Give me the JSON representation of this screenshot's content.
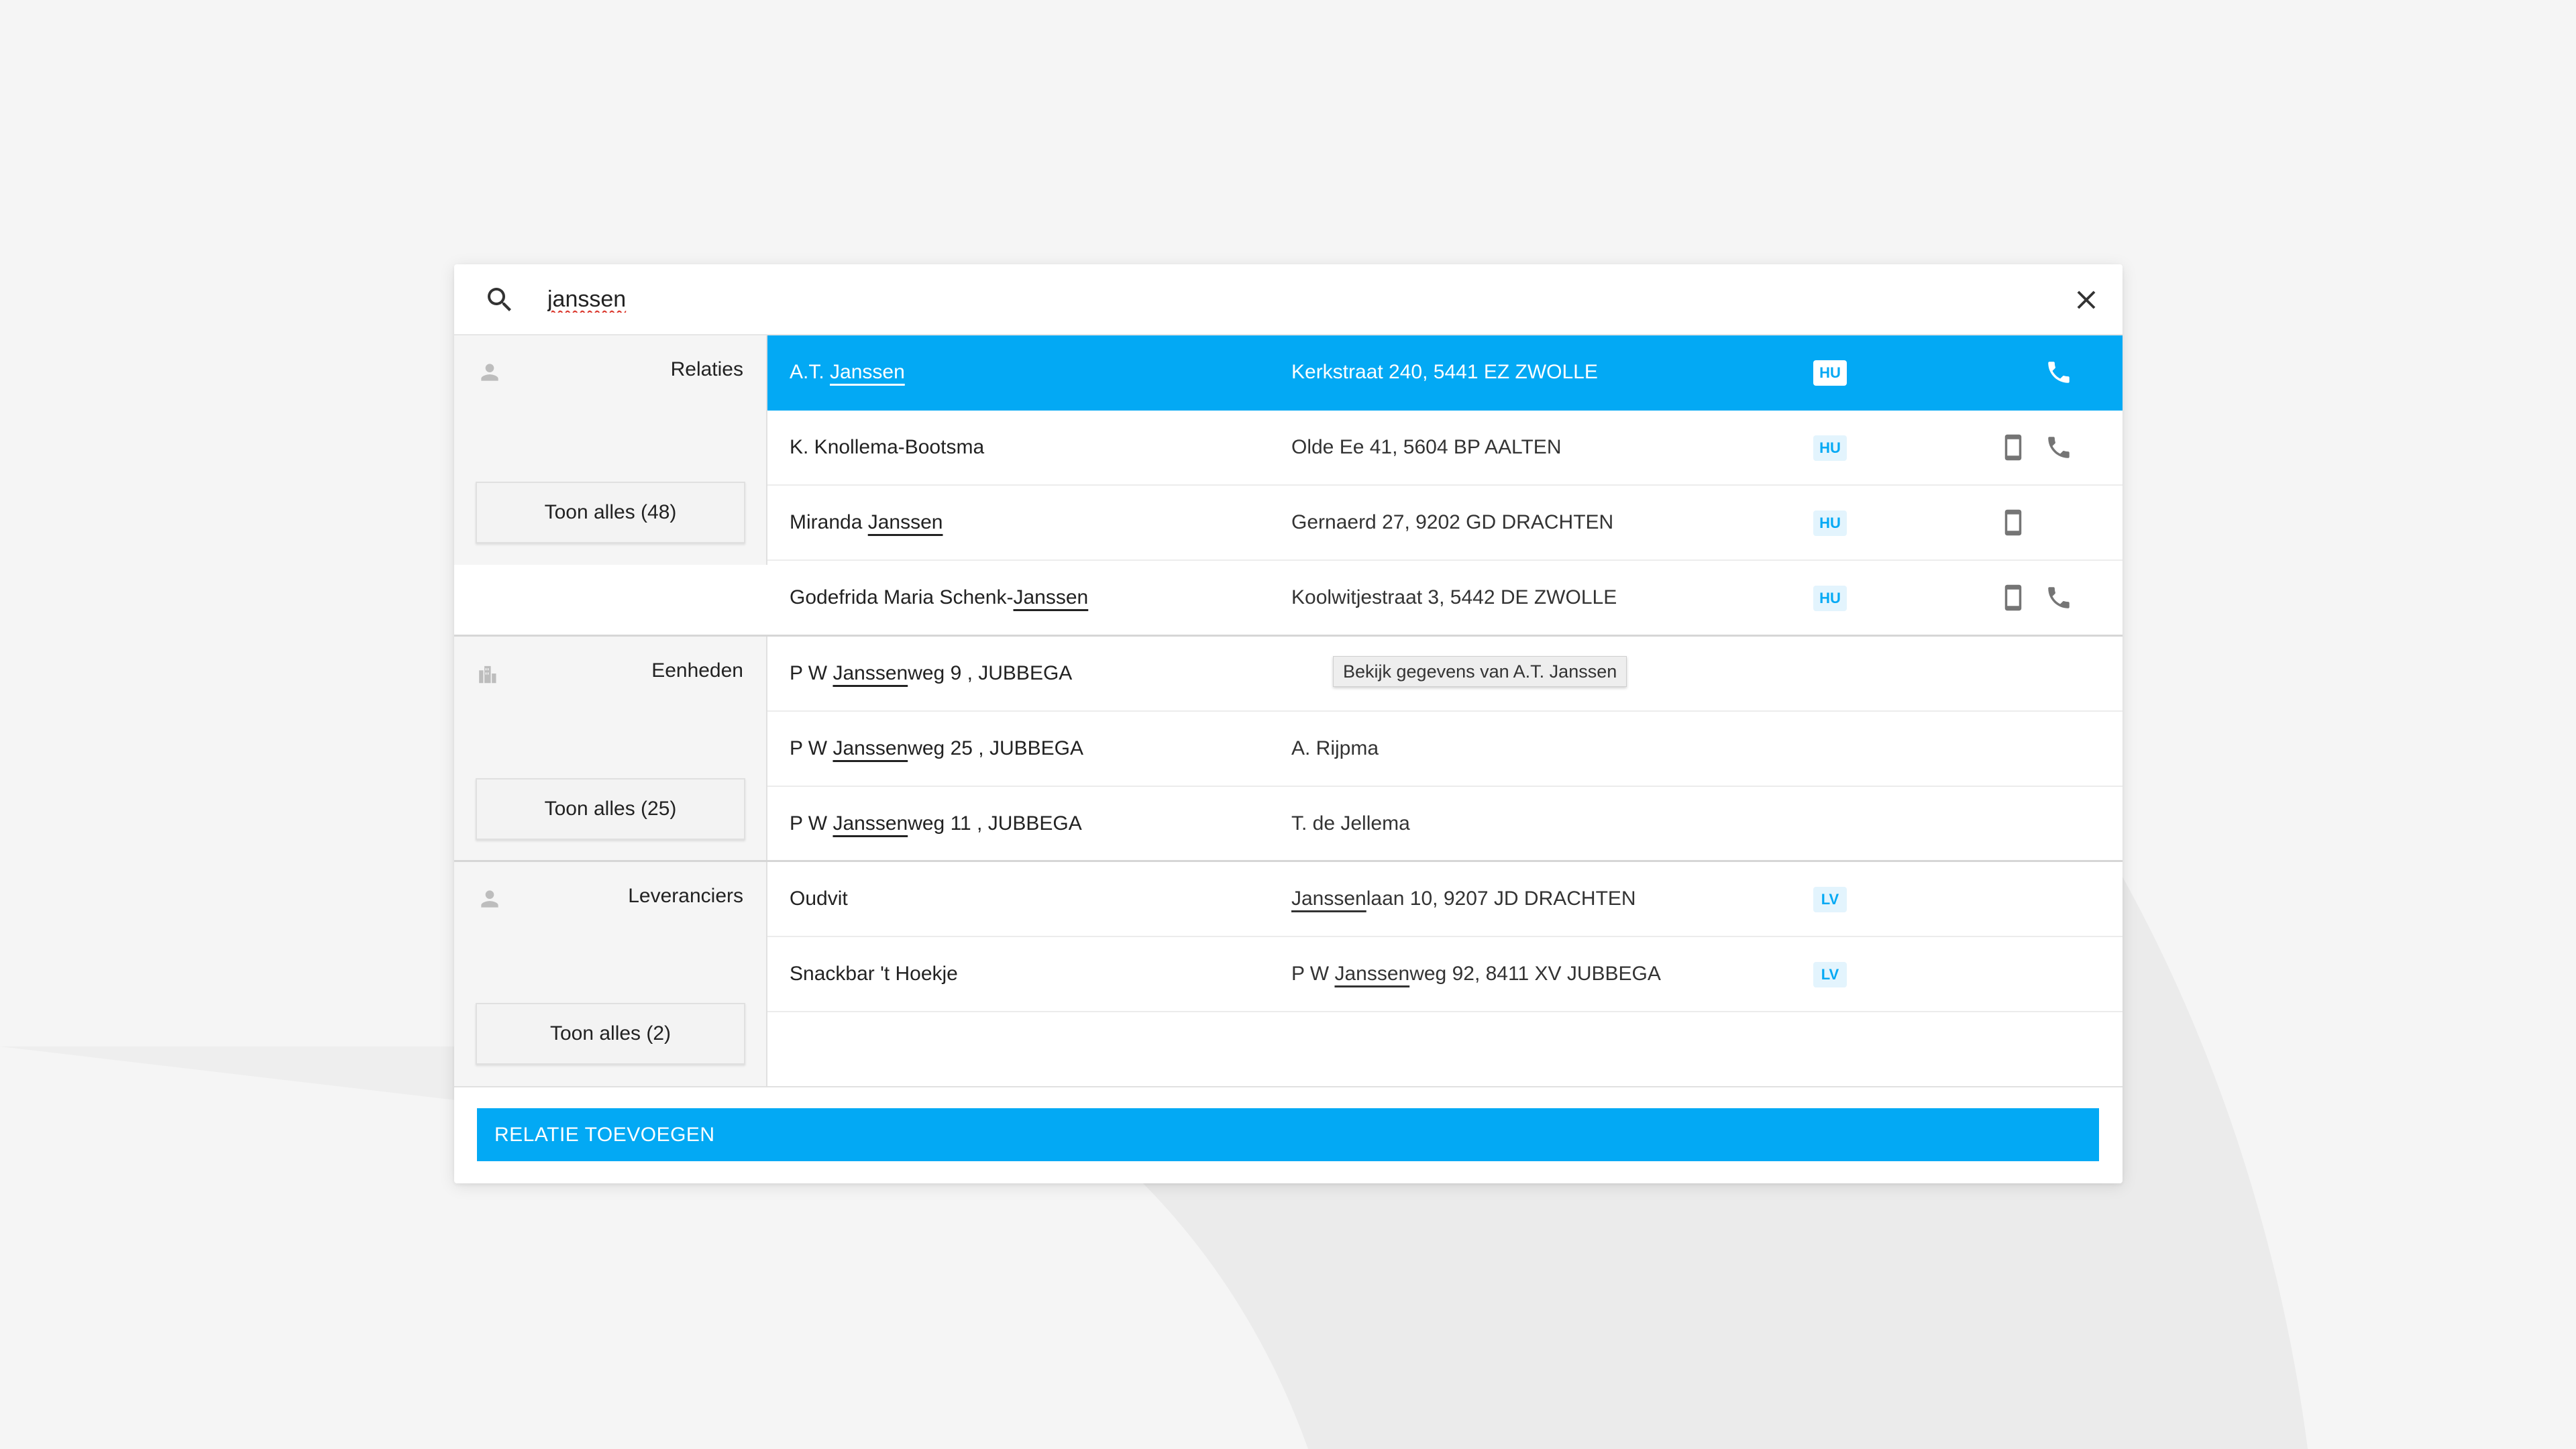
{
  "search": {
    "query": "janssen"
  },
  "tooltip": "Bekijk gegevens van A.T. Janssen",
  "sections": {
    "relaties": {
      "title": "Relaties",
      "show_all": "Toon alles (48)",
      "rows": [
        {
          "name_pre": "A.T. ",
          "name_hl": "Janssen",
          "name_post": "",
          "addr_pre": "Kerkstraat 240, 5441 EZ ZWOLLE",
          "addr_hl": "",
          "addr_post": "",
          "badge": "HU",
          "mobile": false,
          "phone": true
        },
        {
          "name_pre": "K. Knollema-Bootsma",
          "name_hl": "",
          "name_post": "",
          "addr_pre": "Olde Ee 41, 5604 BP AALTEN",
          "addr_hl": "",
          "addr_post": "",
          "badge": "HU",
          "mobile": true,
          "phone": true
        },
        {
          "name_pre": "Miranda ",
          "name_hl": "Janssen",
          "name_post": "",
          "addr_pre": "Gernaerd 27, 9202 GD DRACHTEN",
          "addr_hl": "",
          "addr_post": "",
          "badge": "HU",
          "mobile": true,
          "phone": false
        },
        {
          "name_pre": "Godefrida Maria Schenk-",
          "name_hl": "Janssen",
          "name_post": "",
          "addr_pre": "Koolwitjestraat 3, 5442 DE ZWOLLE",
          "addr_hl": "",
          "addr_post": "",
          "badge": "HU",
          "mobile": true,
          "phone": true
        }
      ]
    },
    "eenheden": {
      "title": "Eenheden",
      "show_all": "Toon alles (25)",
      "rows": [
        {
          "name_pre": "P W ",
          "name_hl": "Janssen",
          "name_post": "weg 9 ,  JUBBEGA",
          "addr_pre": "",
          "addr_hl": "",
          "addr_post": "",
          "badge": "",
          "mobile": false,
          "phone": false
        },
        {
          "name_pre": "P W ",
          "name_hl": "Janssen",
          "name_post": "weg 25 ,  JUBBEGA",
          "addr_pre": "A. Rijpma",
          "addr_hl": "",
          "addr_post": "",
          "badge": "",
          "mobile": false,
          "phone": false
        },
        {
          "name_pre": "P W ",
          "name_hl": "Janssen",
          "name_post": "weg 11 ,  JUBBEGA",
          "addr_pre": "T. de Jellema",
          "addr_hl": "",
          "addr_post": "",
          "badge": "",
          "mobile": false,
          "phone": false
        }
      ]
    },
    "leveranciers": {
      "title": "Leveranciers",
      "show_all": "Toon alles (2)",
      "rows": [
        {
          "name_pre": "Oudvit",
          "name_hl": "",
          "name_post": "",
          "addr_pre": "",
          "addr_hl": "Janssen",
          "addr_post": "laan 10, 9207 JD DRACHTEN",
          "badge": "LV",
          "mobile": false,
          "phone": false
        },
        {
          "name_pre": "Snackbar 't Hoekje",
          "name_hl": "",
          "name_post": "",
          "addr_pre": "P W ",
          "addr_hl": "Janssen",
          "addr_post": "weg 92, 8411 XV JUBBEGA",
          "badge": "LV",
          "mobile": false,
          "phone": false
        }
      ]
    }
  },
  "footer": {
    "add_button": "RELATIE TOEVOEGEN"
  },
  "icons": {
    "search": "search-icon",
    "close": "close-icon",
    "person": "person-icon",
    "building": "building-icon",
    "phone": "phone-icon",
    "mobile": "mobile-icon"
  },
  "colors": {
    "accent": "#03a9f4",
    "badge_bg": "#e3f4fd",
    "panel_bg": "#f5f5f5"
  }
}
